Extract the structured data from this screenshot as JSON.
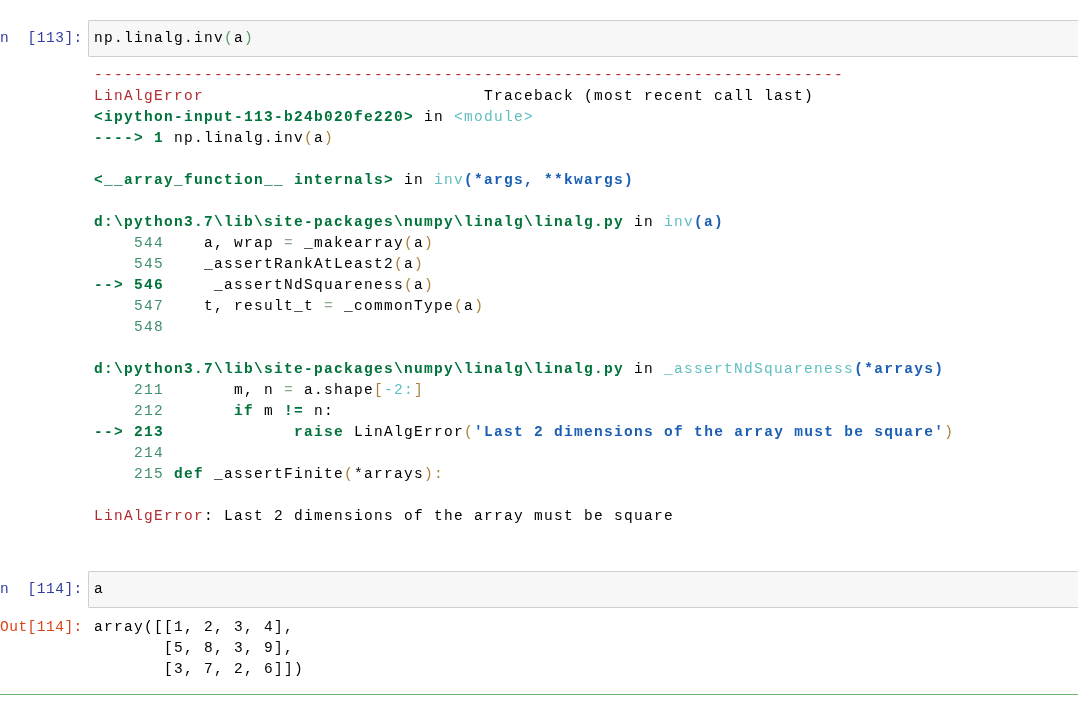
{
  "cells": [
    {
      "kind": "input",
      "prompt": "n  [113]:",
      "code": [
        {
          "text": "np.linalg.inv",
          "kind": "plain"
        },
        {
          "text": "(",
          "kind": "delimiter"
        },
        {
          "text": "a",
          "kind": "plain"
        },
        {
          "text": ")",
          "kind": "delimiter"
        }
      ]
    },
    {
      "kind": "error",
      "blocks": [
        [
          [
            {
              "text": "---------------------------------------------------------------------------",
              "kind": "exception"
            }
          ],
          [
            {
              "text": "LinAlgError",
              "kind": "exception"
            },
            {
              "text": "                            Traceback (most recent call last)",
              "kind": "plain"
            }
          ],
          [
            {
              "text": "<ipython-input-113-b24b020fe220>",
              "kind": "path"
            },
            {
              "text": " in ",
              "kind": "plain"
            },
            {
              "text": "<module>",
              "kind": "name"
            }
          ],
          [
            {
              "text": "----> 1",
              "kind": "marker"
            },
            {
              "text": " np.linalg.inv",
              "kind": "plain"
            },
            {
              "text": "(",
              "kind": "bracket"
            },
            {
              "text": "a",
              "kind": "plain"
            },
            {
              "text": ")",
              "kind": "bracket"
            }
          ]
        ],
        [
          [
            {
              "text": "<__array_function__ internals>",
              "kind": "path"
            },
            {
              "text": " in ",
              "kind": "plain"
            },
            {
              "text": "inv",
              "kind": "name"
            },
            {
              "text": "(*args, **kwargs)",
              "kind": "args"
            }
          ]
        ],
        [
          [
            {
              "text": "d:\\python3.7\\lib\\site-packages\\numpy\\linalg\\linalg.py",
              "kind": "path"
            },
            {
              "text": " in ",
              "kind": "plain"
            },
            {
              "text": "inv",
              "kind": "name"
            },
            {
              "text": "(a)",
              "kind": "args"
            }
          ],
          [
            {
              "text": "    544",
              "kind": "number"
            },
            {
              "text": "    a, wrap ",
              "kind": "plain"
            },
            {
              "text": "=",
              "kind": "operator"
            },
            {
              "text": " _makearray",
              "kind": "plain"
            },
            {
              "text": "(",
              "kind": "bracket"
            },
            {
              "text": "a",
              "kind": "plain"
            },
            {
              "text": ")",
              "kind": "bracket"
            }
          ],
          [
            {
              "text": "    545",
              "kind": "number"
            },
            {
              "text": "    _assertRankAtLeast2",
              "kind": "plain"
            },
            {
              "text": "(",
              "kind": "bracket"
            },
            {
              "text": "a",
              "kind": "plain"
            },
            {
              "text": ")",
              "kind": "bracket"
            }
          ],
          [
            {
              "text": "--> 546",
              "kind": "marker"
            },
            {
              "text": "     _assertNdSquareness",
              "kind": "plain"
            },
            {
              "text": "(",
              "kind": "bracket"
            },
            {
              "text": "a",
              "kind": "plain"
            },
            {
              "text": ")",
              "kind": "bracket"
            }
          ],
          [
            {
              "text": "    547",
              "kind": "number"
            },
            {
              "text": "    t, result_t ",
              "kind": "plain"
            },
            {
              "text": "=",
              "kind": "operator"
            },
            {
              "text": " _commonType",
              "kind": "plain"
            },
            {
              "text": "(",
              "kind": "bracket"
            },
            {
              "text": "a",
              "kind": "plain"
            },
            {
              "text": ")",
              "kind": "bracket"
            }
          ],
          [
            {
              "text": "    548",
              "kind": "number"
            }
          ]
        ],
        [
          [
            {
              "text": "d:\\python3.7\\lib\\site-packages\\numpy\\linalg\\linalg.py",
              "kind": "path"
            },
            {
              "text": " in ",
              "kind": "plain"
            },
            {
              "text": "_assertNdSquareness",
              "kind": "name"
            },
            {
              "text": "(*arrays)",
              "kind": "args"
            }
          ],
          [
            {
              "text": "    211",
              "kind": "number"
            },
            {
              "text": "       m, n ",
              "kind": "plain"
            },
            {
              "text": "=",
              "kind": "operator"
            },
            {
              "text": " a.shape",
              "kind": "plain"
            },
            {
              "text": "[",
              "kind": "bracket"
            },
            {
              "text": "-2:",
              "kind": "name"
            },
            {
              "text": "]",
              "kind": "bracket"
            }
          ],
          [
            {
              "text": "    212       ",
              "kind": "number"
            },
            {
              "text": "if",
              "kind": "keyword"
            },
            {
              "text": " m ",
              "kind": "plain"
            },
            {
              "text": "!=",
              "kind": "keyword"
            },
            {
              "text": " n:",
              "kind": "plain"
            }
          ],
          [
            {
              "text": "--> 213             ",
              "kind": "marker"
            },
            {
              "text": "raise",
              "kind": "keyword"
            },
            {
              "text": " LinAlgError",
              "kind": "plain"
            },
            {
              "text": "(",
              "kind": "bracket"
            },
            {
              "text": "'Last 2 dimensions of the array must be square'",
              "kind": "string"
            },
            {
              "text": ")",
              "kind": "bracket"
            }
          ],
          [
            {
              "text": "    214",
              "kind": "number"
            }
          ],
          [
            {
              "text": "    215 ",
              "kind": "number"
            },
            {
              "text": "def",
              "kind": "keyword"
            },
            {
              "text": " _assertFinite",
              "kind": "plain"
            },
            {
              "text": "(",
              "kind": "bracket"
            },
            {
              "text": "*arrays",
              "kind": "plain"
            },
            {
              "text": "):",
              "kind": "bracket"
            }
          ]
        ],
        [
          [
            {
              "text": "LinAlgError",
              "kind": "exception"
            },
            {
              "text": ": Last 2 dimensions of the array must be square",
              "kind": "plain"
            }
          ]
        ]
      ]
    },
    {
      "kind": "input",
      "prompt": "n  [114]:",
      "code": [
        {
          "text": "a",
          "kind": "plain"
        }
      ]
    },
    {
      "kind": "result",
      "prompt": "Out[114]:",
      "lines": [
        [
          {
            "text": "array([[1, 2, 3, 4],",
            "kind": "plain"
          }
        ],
        [
          {
            "text": "       [5, 8, 3, 9],",
            "kind": "plain"
          }
        ],
        [
          {
            "text": "       [3, 7, 2, 6]])",
            "kind": "plain"
          }
        ]
      ]
    }
  ]
}
